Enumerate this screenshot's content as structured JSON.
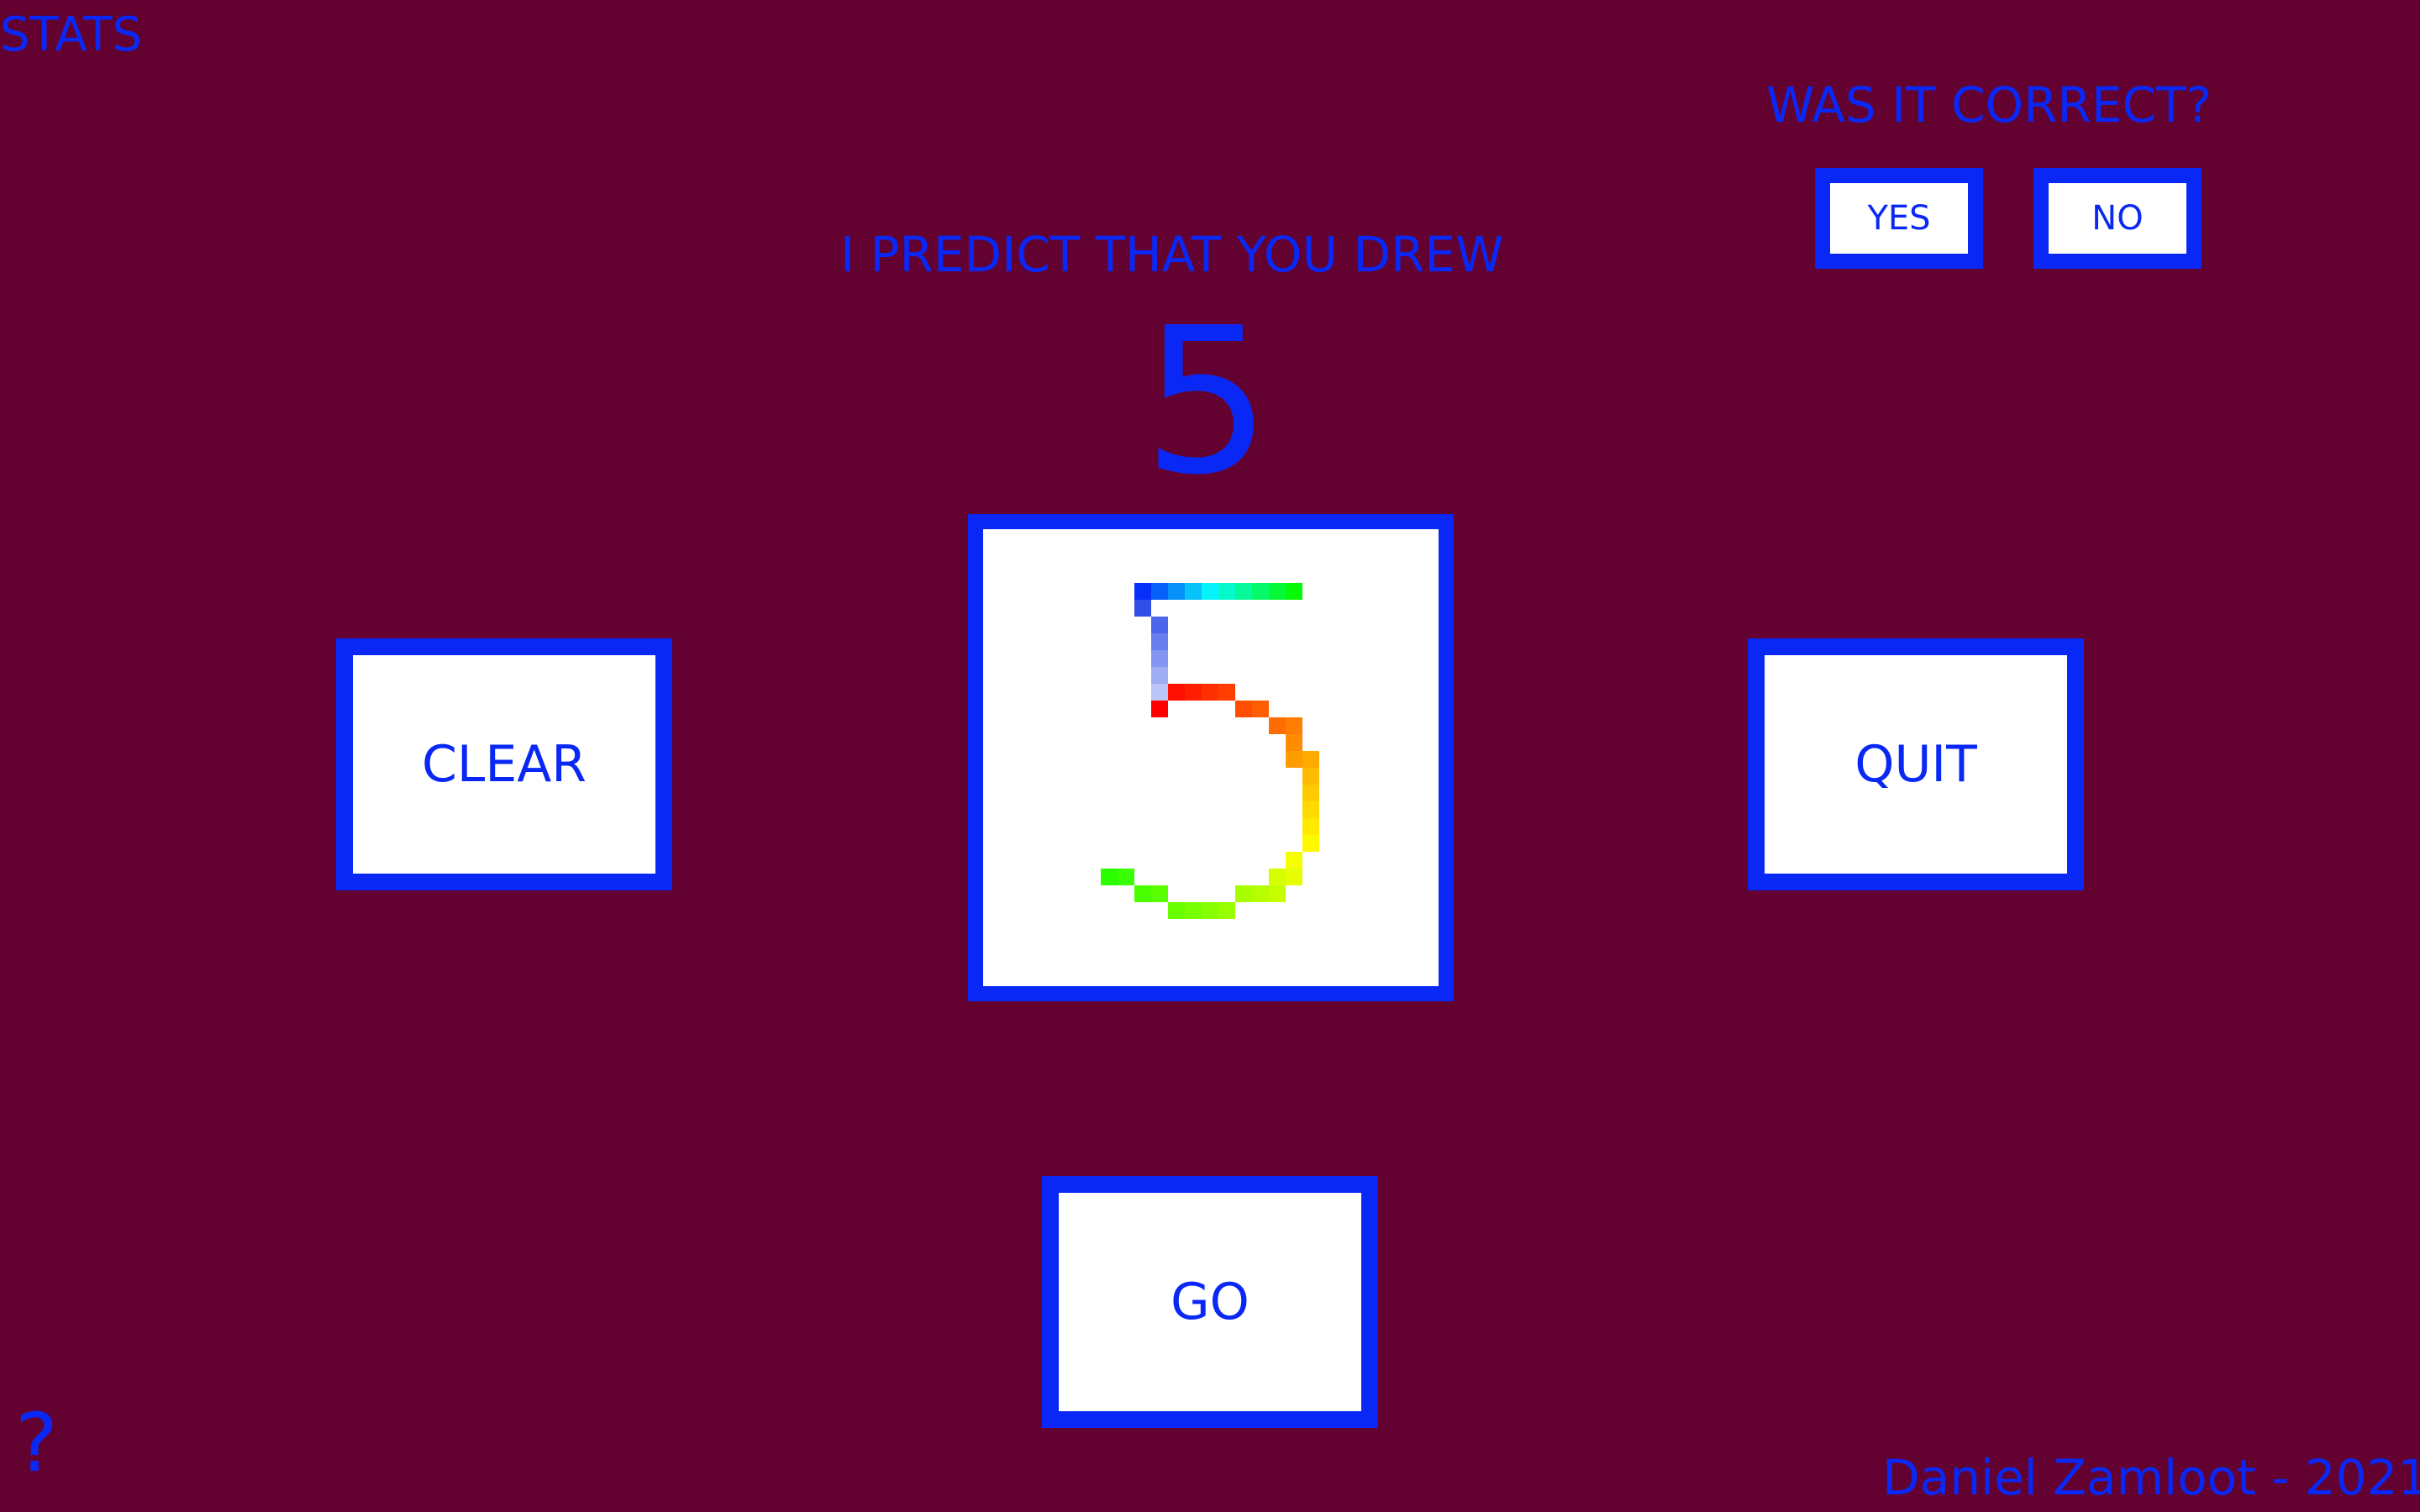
{
  "header": {
    "stats_label": "STATS"
  },
  "feedback": {
    "question": "WAS IT CORRECT?",
    "yes_label": "YES",
    "no_label": "NO"
  },
  "prediction": {
    "label": "I PREDICT THAT YOU DREW",
    "digit": "5"
  },
  "controls": {
    "clear_label": "CLEAR",
    "quit_label": "QUIT",
    "go_label": "GO"
  },
  "footer": {
    "help_label": "?",
    "credit": "Daniel Zamloot - 2021"
  },
  "colors": {
    "background": "#630230",
    "accent": "#0a28f5",
    "panel": "#ffffff"
  }
}
